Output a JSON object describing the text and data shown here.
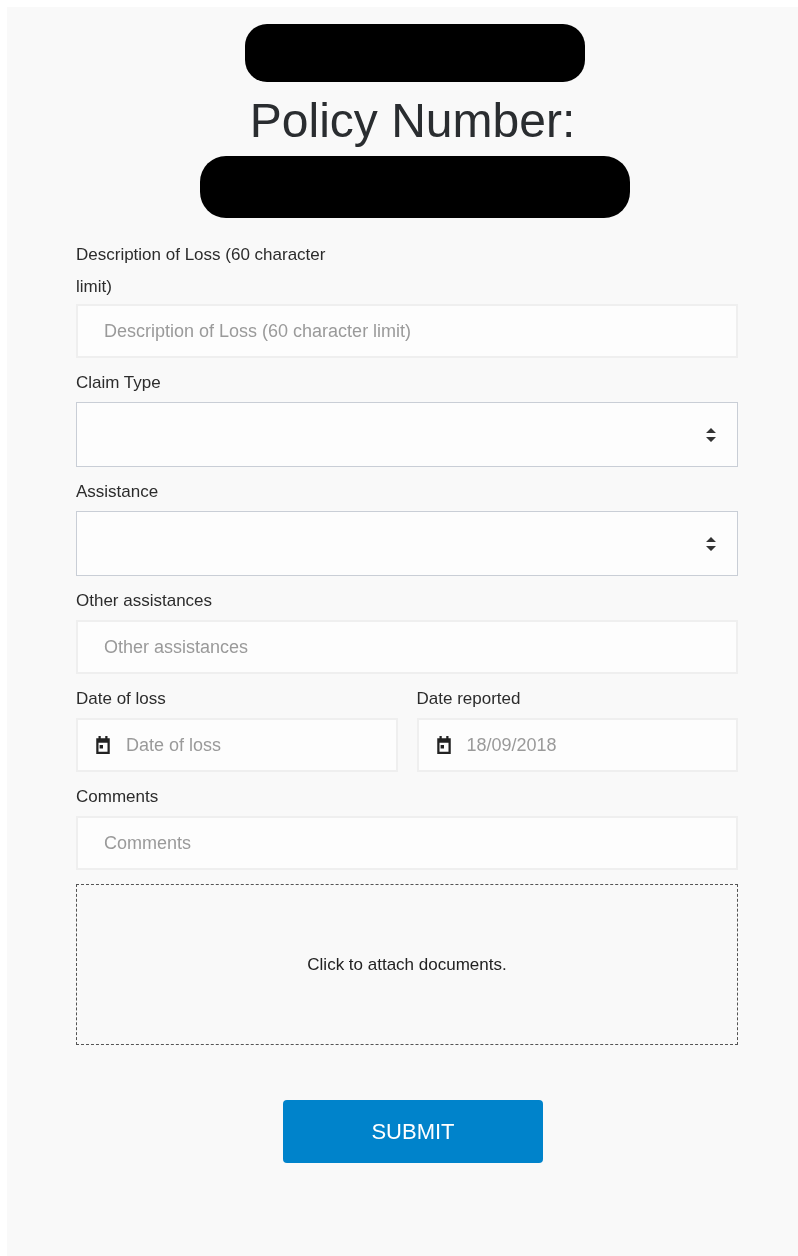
{
  "title": "Policy Number:",
  "fields": [
    {
      "kind": "text",
      "label": "Description of Loss (60 character limit)",
      "placeholder": "Description of Loss (60 character limit)"
    },
    {
      "kind": "select",
      "label": "Claim Type"
    },
    {
      "kind": "select",
      "label": "Assistance"
    },
    {
      "kind": "text",
      "label": "Other assistances",
      "placeholder": "Other assistances"
    },
    {
      "kind": "dates",
      "dates": [
        {
          "label": "Date of loss",
          "placeholder": "Date of loss"
        },
        {
          "label": "Date reported",
          "value": "18/09/2018"
        }
      ]
    },
    {
      "kind": "text",
      "label": "Comments",
      "placeholder": "Comments"
    }
  ],
  "attach": "Click to attach documents.",
  "submit": "SUBMIT"
}
